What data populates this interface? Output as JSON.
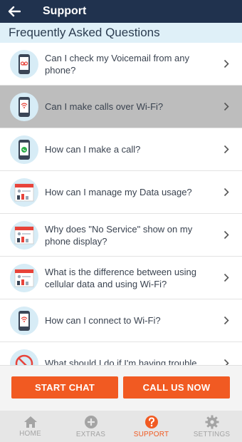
{
  "header": {
    "title": "Support"
  },
  "section": {
    "title": "Frequently Asked Questions"
  },
  "colors": {
    "navy": "#20324e",
    "accent": "#f15a22",
    "selected_row": "#bdbdbd",
    "icon_circle": "#d7ecf6"
  },
  "faq": [
    {
      "question": "Can I check my Voicemail from any phone?",
      "icon": "voicemail-phone-icon"
    },
    {
      "question": "Can I make calls over Wi-Fi?",
      "icon": "wifi-calling-phone-icon",
      "selected": true
    },
    {
      "question": "How can I make a call?",
      "icon": "call-phone-icon"
    },
    {
      "question": "How can I manage my Data usage?",
      "icon": "data-usage-icon"
    },
    {
      "question": "Why does \"No Service\" show on my phone display?",
      "icon": "no-service-icon"
    },
    {
      "question": "What is the difference between using cellular data and using Wi-Fi?",
      "icon": "cellular-vs-wifi-icon"
    },
    {
      "question": "How can I connect to Wi-Fi?",
      "icon": "wifi-connect-phone-icon"
    },
    {
      "question": "What should I do if I'm having trouble",
      "icon": "trouble-icon"
    }
  ],
  "buttons": {
    "chat": "START CHAT",
    "call": "CALL US NOW"
  },
  "nav": [
    {
      "label": "HOME",
      "icon": "home-icon"
    },
    {
      "label": "EXTRAS",
      "icon": "plus-circle-icon"
    },
    {
      "label": "SUPPORT",
      "icon": "question-circle-icon",
      "active": true
    },
    {
      "label": "SETTINGS",
      "icon": "gear-icon"
    }
  ]
}
